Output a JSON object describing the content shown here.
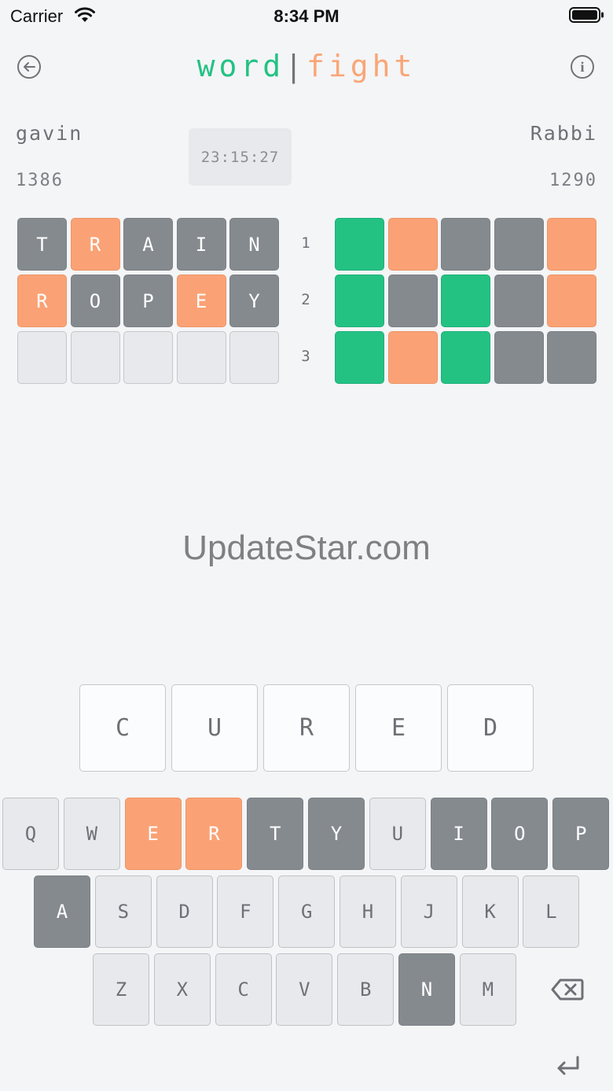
{
  "status_bar": {
    "carrier": "Carrier",
    "time": "8:34 PM"
  },
  "header": {
    "title_word": "word",
    "title_sep": "|",
    "title_fight": "fight",
    "back_icon": "back-arrow-icon",
    "info_icon": "info-icon"
  },
  "players": {
    "left": {
      "name": "gavin",
      "score": "1386"
    },
    "right": {
      "name": "Rabbi",
      "score": "1290"
    }
  },
  "timer": "23:15:27",
  "colors": {
    "green": "#23c283",
    "orange": "#faa276",
    "gray": "#858a8f",
    "empty": "#e8e9ec"
  },
  "left_board": [
    [
      {
        "l": "T",
        "s": "gray"
      },
      {
        "l": "R",
        "s": "orange"
      },
      {
        "l": "A",
        "s": "gray"
      },
      {
        "l": "I",
        "s": "gray"
      },
      {
        "l": "N",
        "s": "gray"
      }
    ],
    [
      {
        "l": "R",
        "s": "orange"
      },
      {
        "l": "O",
        "s": "gray"
      },
      {
        "l": "P",
        "s": "gray"
      },
      {
        "l": "E",
        "s": "orange"
      },
      {
        "l": "Y",
        "s": "gray"
      }
    ],
    [
      {
        "l": "",
        "s": "empty"
      },
      {
        "l": "",
        "s": "empty"
      },
      {
        "l": "",
        "s": "empty"
      },
      {
        "l": "",
        "s": "empty"
      },
      {
        "l": "",
        "s": "empty"
      }
    ]
  ],
  "row_numbers": [
    "1",
    "2",
    "3"
  ],
  "right_board": [
    [
      "green",
      "orange",
      "gray",
      "gray",
      "orange"
    ],
    [
      "green",
      "gray",
      "green",
      "gray",
      "orange"
    ],
    [
      "green",
      "orange",
      "green",
      "gray",
      "gray"
    ]
  ],
  "watermark": "UpdateStar.com",
  "current_guess": [
    "C",
    "U",
    "R",
    "E",
    "D"
  ],
  "keyboard": {
    "row1": [
      {
        "k": "Q",
        "s": "light"
      },
      {
        "k": "W",
        "s": "light"
      },
      {
        "k": "E",
        "s": "orange"
      },
      {
        "k": "R",
        "s": "orange"
      },
      {
        "k": "T",
        "s": "gray"
      },
      {
        "k": "Y",
        "s": "gray"
      },
      {
        "k": "U",
        "s": "light"
      },
      {
        "k": "I",
        "s": "gray"
      },
      {
        "k": "O",
        "s": "gray"
      },
      {
        "k": "P",
        "s": "gray"
      }
    ],
    "row2": [
      {
        "k": "A",
        "s": "gray"
      },
      {
        "k": "S",
        "s": "light"
      },
      {
        "k": "D",
        "s": "light"
      },
      {
        "k": "F",
        "s": "light"
      },
      {
        "k": "G",
        "s": "light"
      },
      {
        "k": "H",
        "s": "light"
      },
      {
        "k": "J",
        "s": "light"
      },
      {
        "k": "K",
        "s": "light"
      },
      {
        "k": "L",
        "s": "light"
      }
    ],
    "row3": [
      {
        "k": "Z",
        "s": "light"
      },
      {
        "k": "X",
        "s": "light"
      },
      {
        "k": "C",
        "s": "light"
      },
      {
        "k": "V",
        "s": "light"
      },
      {
        "k": "B",
        "s": "light"
      },
      {
        "k": "N",
        "s": "gray"
      },
      {
        "k": "M",
        "s": "light"
      }
    ],
    "backspace_icon": "backspace-icon",
    "enter_icon": "enter-icon"
  }
}
